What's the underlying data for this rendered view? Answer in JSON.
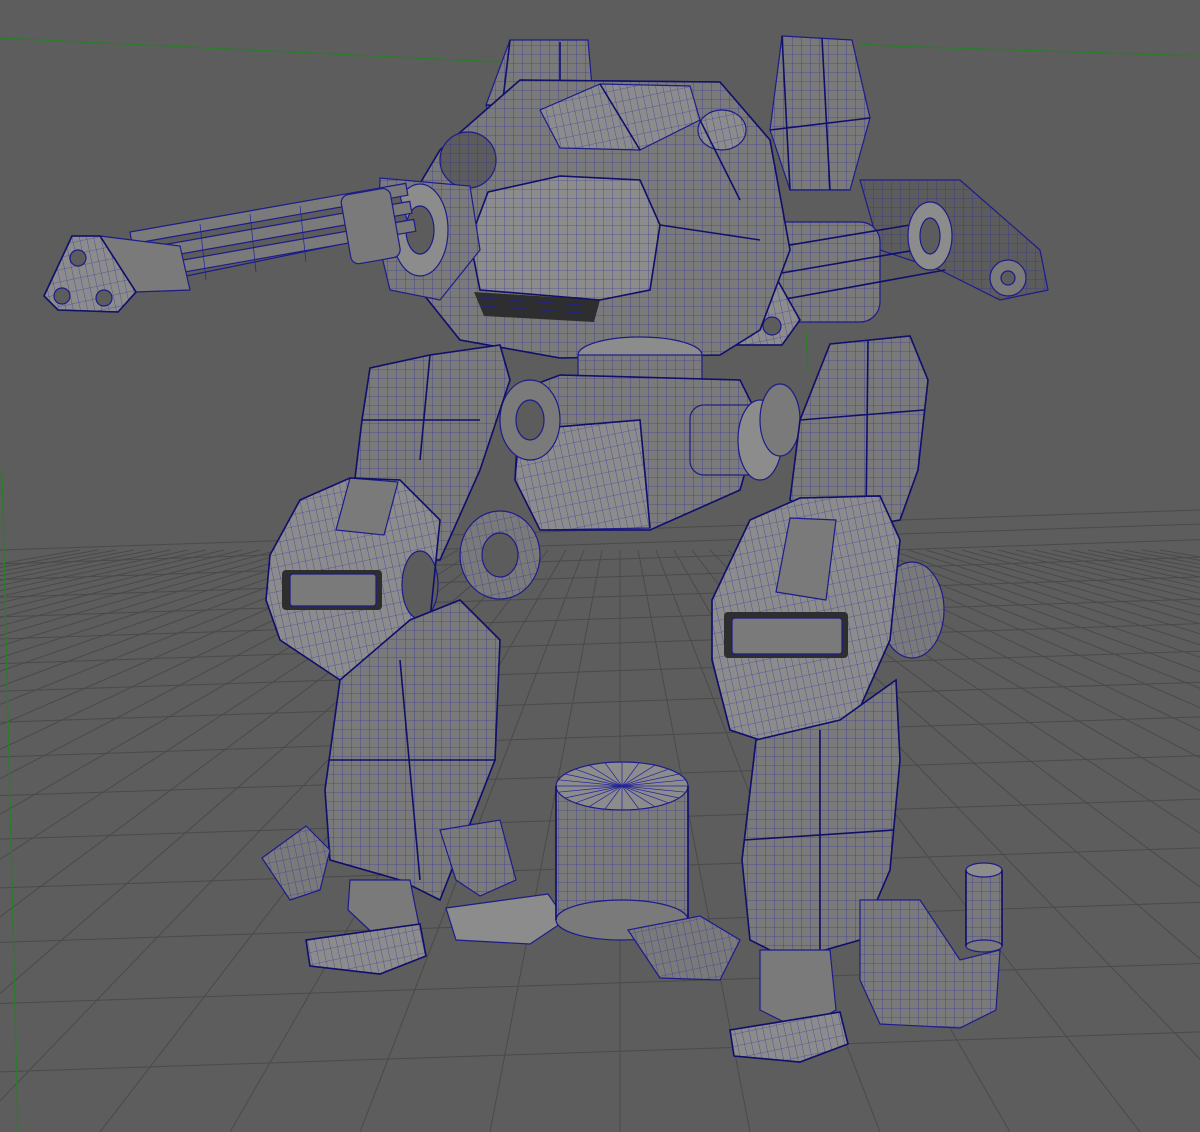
{
  "viewport": {
    "background": "#5d5d5d",
    "grid_color": "#4a4a4a",
    "axis_color": "#2f7a2f",
    "wireframe_color": "#1c1c8a",
    "mesh_color": "#7a7a7a"
  },
  "scene": {
    "objects": [
      {
        "name": "mech-torso"
      },
      {
        "name": "left-gatling-gun"
      },
      {
        "name": "right-gatling-gun"
      },
      {
        "name": "left-leg"
      },
      {
        "name": "right-leg"
      },
      {
        "name": "pelvis-turret"
      },
      {
        "name": "cylinder-primitive-large"
      },
      {
        "name": "cylinder-primitive-small"
      }
    ]
  }
}
